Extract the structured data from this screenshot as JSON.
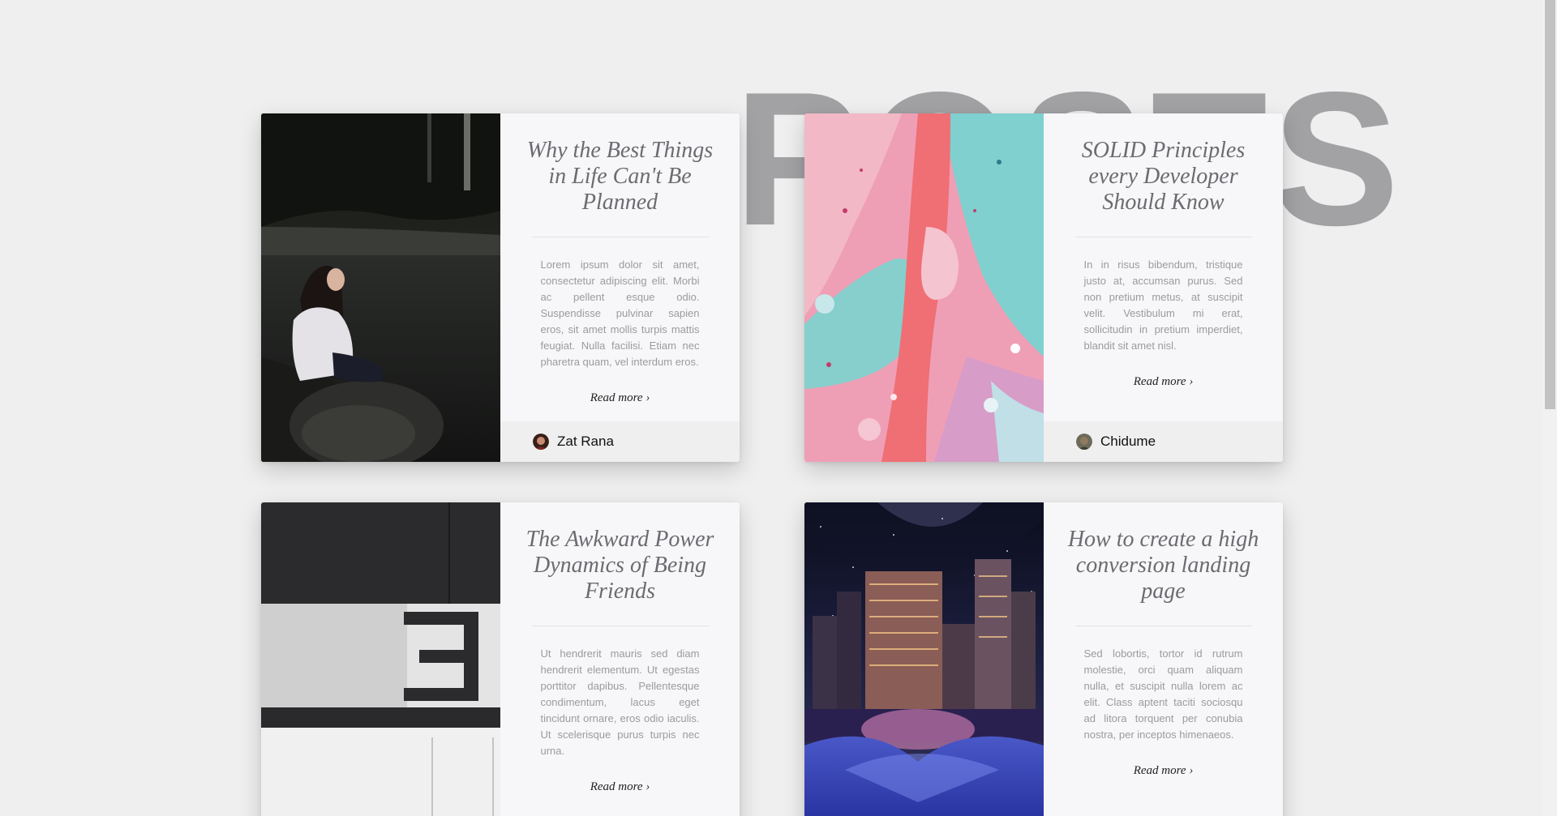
{
  "page": {
    "heading": "POSTS"
  },
  "posts": [
    {
      "title": "Why the Best Things in Life Can't Be Planned",
      "excerpt": "Lorem ipsum dolor sit amet, consectetur adipiscing elit. Morbi ac pellent esque odio. Suspendisse pulvinar sapien eros, sit amet mollis turpis mattis feugiat. Nulla facilisi. Etiam nec pharetra quam, vel interdum eros.",
      "read_more": "Read more ›",
      "author": "Zat Rana",
      "image_icon": "photo-girl-by-lake-icon"
    },
    {
      "title": "SOLID Principles every Developer Should Know",
      "excerpt": "In in risus bibendum, tristique justo at, accumsan purus. Sed non pretium metus, at suscipit velit. Vestibulum mi erat, sollicitudin in pretium imperdiet, blandit sit amet nisl.",
      "read_more": "Read more ›",
      "author": "Chidume",
      "image_icon": "photo-fluid-paint-icon"
    },
    {
      "title": "The Awkward Power Dynamics of Being Friends",
      "excerpt": "Ut hendrerit mauris sed diam hendrerit elementum. Ut egestas porttitor dapibus. Pellentesque condimentum, lacus eget tincidunt ornare, eros odio iaculis. Ut scelerisque purus turpis nec urna.",
      "read_more": "Read more ›",
      "author": "",
      "image_icon": "photo-architecture-number-three-icon"
    },
    {
      "title": "How to create a high conversion landing page",
      "excerpt": "Sed lobortis, tortor id rutrum molestie, orci quam aliquam nulla, et suscipit nulla lorem ac elit. Class aptent taciti sociosqu ad litora torquent per conubia nostra, per inceptos himenaeos.",
      "read_more": "Read more ›",
      "author": "",
      "image_icon": "photo-night-city-icon"
    }
  ]
}
